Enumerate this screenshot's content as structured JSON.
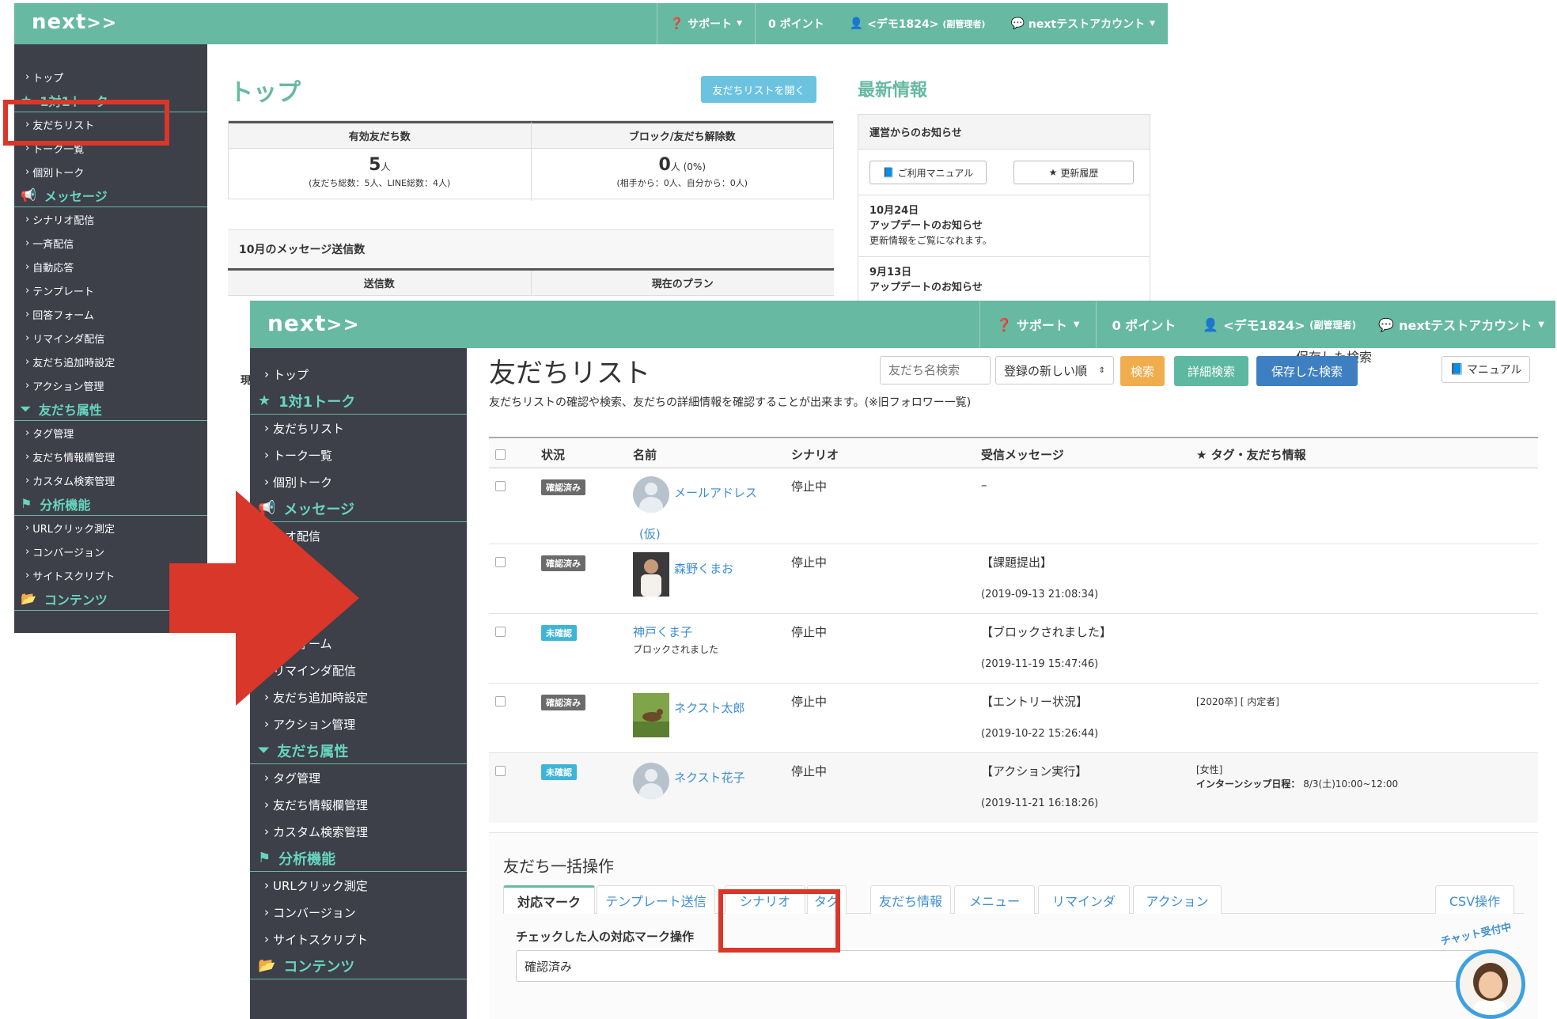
{
  "app": {
    "logo": "next"
  },
  "topbar": {
    "support": "サポート",
    "points": "0 ポイント",
    "user": "<デモ1824>",
    "role": "(副管理者)",
    "account": "nextテストアカウント"
  },
  "sidebar": {
    "top": "トップ",
    "section_talk": "1対1トーク",
    "friend_list": "友だちリスト",
    "talk_list": "トーク一覧",
    "individual_talk": "個別トーク",
    "section_message": "メッセージ",
    "scenario": "シナリオ配信",
    "broadcast": "一斉配信",
    "auto_reply": "自動応答",
    "template": "テンプレート",
    "answer_form": "回答フォーム",
    "reminder": "リマインダ配信",
    "add_friend_setting": "友だち追加時設定",
    "action_manage": "アクション管理",
    "section_attr": "友だち属性",
    "tag_manage": "タグ管理",
    "info_field": "友だち情報欄管理",
    "custom_search": "カスタム検索管理",
    "section_analysis": "分析機能",
    "url_click": "URLクリック測定",
    "conversion": "コンバージョン",
    "site_script": "サイトスクリプト",
    "section_contents": "コンテンツ",
    "partial_scenario": "リオ配信",
    "partial_template": "ート",
    "partial_answer": "答フォーム",
    "partial_message": "メッセージ"
  },
  "back": {
    "page_title": "トップ",
    "open_list_button": "友だちリストを開く",
    "stats": {
      "col1_head": "有効友だち数",
      "col1_value": "5",
      "col1_unit": "人",
      "col1_sub": "(友だち総数：5人、LINE総数：4人)",
      "col2_head": "ブロック/友だち解除数",
      "col2_value": "0",
      "col2_unit": "人 (0%)",
      "col2_sub": "(相手から：0人、自分から：0人)"
    },
    "msg_section_title": "10月のメッセージ送信数",
    "msg_col1": "送信数",
    "msg_col2": "現在のプラン",
    "news_title": "最新情報",
    "news_header": "運営からのお知らせ",
    "manual_button": "ご利用マニュアル",
    "history_button": "更新履歴",
    "news1_date": "10月24日",
    "news1_title": "アップデートのお知らせ",
    "news1_body": "更新情報をご覧になれます。",
    "news2_date": "9月13日",
    "news2_title": "アップデートのお知らせ",
    "partial_label": "現"
  },
  "front": {
    "page_title": "友だちリスト",
    "search_placeholder": "友だち名検索",
    "sort_value": "登録の新しい順",
    "search_button": "検索",
    "detail_search_button": "詳細検索",
    "saved_search_button": "保存した検索",
    "manual_button": "マニュアル",
    "description": "友だちリストの確認や検索、友だちの詳細情報を確認することが出来ます。(※旧フォロワー一覧)",
    "columns": [
      "状況",
      "名前",
      "シナリオ",
      "受信メッセージ",
      "★ タグ・友だち情報"
    ],
    "rows": [
      {
        "status": "確認済み",
        "name": "メールアドレス",
        "name2": "(仮)",
        "scenario": "停止中",
        "message": "–",
        "time": "",
        "tags": "",
        "info_label": "",
        "info_value": ""
      },
      {
        "status": "確認済み",
        "name": "森野くまお",
        "name2": "",
        "scenario": "停止中",
        "message": "【課題提出】",
        "time": "(2019-09-13 21:08:34)",
        "tags": "",
        "info_label": "",
        "info_value": ""
      },
      {
        "status": "未確認",
        "name": "神戸くま子",
        "name2": "ブロックされました",
        "scenario": "停止中",
        "message": "【ブロックされました】",
        "time": "(2019-11-19 15:47:46)",
        "tags": "",
        "info_label": "",
        "info_value": ""
      },
      {
        "status": "確認済み",
        "name": "ネクスト太郎",
        "name2": "",
        "scenario": "停止中",
        "message": "【エントリー状況】",
        "time": "(2019-10-22 15:26:44)",
        "tags": "[2020卒] [ 内定者]",
        "info_label": "",
        "info_value": ""
      },
      {
        "status": "未確認",
        "name": "ネクスト花子",
        "name2": "",
        "scenario": "停止中",
        "message": "【アクション実行】",
        "time": "(2019-11-21 16:18:26)",
        "tags": "[女性]",
        "info_label": "インターンシップ日程：",
        "info_value": "8/3(土)10:00~12:00"
      }
    ],
    "bulk_title": "友だち一括操作",
    "tabs": [
      "対応マーク",
      "テンプレート送信",
      "シナリオ",
      "タグ",
      "友だち情報",
      "メニュー",
      "リマインダ",
      "アクション",
      "CSV操作"
    ],
    "mark_label": "チェックした人の対応マーク操作",
    "mark_value": "確認済み",
    "chat_badge": "チャット受付中"
  },
  "colors": {
    "accent": "#67b9a2",
    "sidebar": "#3d3f49",
    "highlight": "#d9372a",
    "link": "#3d8ed1"
  }
}
